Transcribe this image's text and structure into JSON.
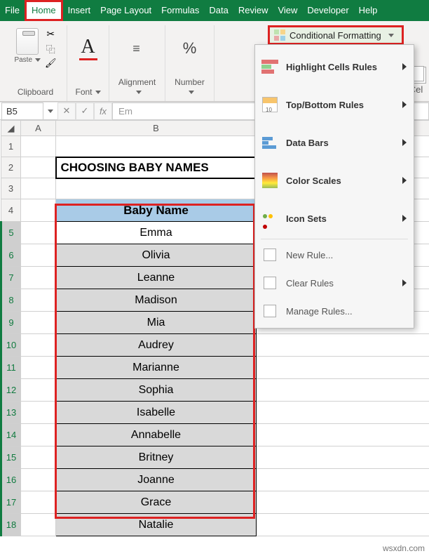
{
  "menu": {
    "file": "File",
    "home": "Home",
    "insert": "Insert",
    "page_layout": "Page Layout",
    "formulas": "Formulas",
    "data": "Data",
    "review": "Review",
    "view": "View",
    "developer": "Developer",
    "help": "Help"
  },
  "ribbon": {
    "clipboard": {
      "paste": "Paste",
      "label": "Clipboard"
    },
    "font": {
      "label": "Font"
    },
    "alignment": {
      "label": "Alignment"
    },
    "number": {
      "label": "Number"
    },
    "cf_button": "Conditional Formatting",
    "cells": "Cel"
  },
  "cf_menu": {
    "highlight": "Highlight Cells Rules",
    "topbottom": "Top/Bottom Rules",
    "databars": "Data Bars",
    "colorscales": "Color Scales",
    "iconsets": "Icon Sets",
    "newrule": "New Rule...",
    "clear": "Clear Rules",
    "manage": "Manage Rules..."
  },
  "namebox": "B5",
  "formula_hint": "Em",
  "columns": {
    "A": "A",
    "B": "B"
  },
  "rows": [
    "1",
    "2",
    "3",
    "4",
    "5",
    "6",
    "7",
    "8",
    "9",
    "10",
    "11",
    "12",
    "13",
    "14",
    "15",
    "16",
    "17",
    "18"
  ],
  "title": "CHOOSING BABY NAMES",
  "header": "Baby Name",
  "names": [
    "Emma",
    "Olivia",
    "Leanne",
    "Madison",
    "Mia",
    "Audrey",
    "Marianne",
    "Sophia",
    "Isabelle",
    "Annabelle",
    "Britney",
    "Joanne",
    "Grace",
    "Natalie"
  ],
  "watermark": "wsxdn.com"
}
